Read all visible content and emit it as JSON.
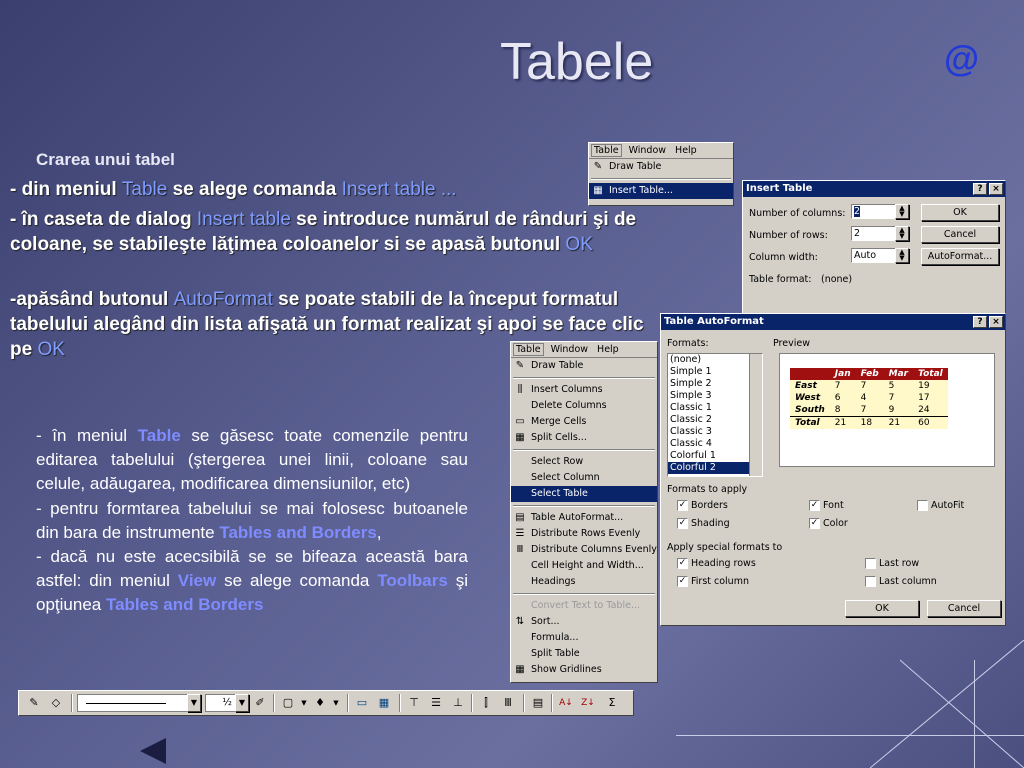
{
  "slide": {
    "title": "Tabele",
    "at_symbol": "@",
    "subtitle": "Crarea unui tabel",
    "lines": [
      {
        "a": "- din meniul ",
        "b": "Table",
        "c": " se alege comanda ",
        "d": "Insert table ..."
      },
      {
        "a": "- în caseta de dialog ",
        "b": "Insert table",
        "c": " se introduce numărul de rânduri şi de coloane, se stabileşte lăţimea coloanelor si se apasă butonul ",
        "d": "OK"
      },
      {
        "a": "-apăsând butonul ",
        "b": "AutoFormat",
        "c": " se poate stabili de la început formatul tabelului alegând din lista afişată un format realizat şi apoi se face clic pe ",
        "d": "OK"
      }
    ],
    "para2": {
      "p1a": "- în meniul ",
      "p1b": "Table",
      "p1c": "  se găsesc toate comenzile pentru editarea tabelului (ştergerea unei linii, coloane sau celule, adăugarea, modificarea dimensiunilor, etc)",
      "p2a": "- pentru formtarea tabelului se mai folosesc butoanele din bara de instrumente ",
      "p2b": "Tables and Borders",
      "p2c": ",",
      "p3a": "- dacă nu este acecsibilă se se bifeaza această bara astfel: din meniul ",
      "p3b": "View",
      "p3c": "  se alege comanda ",
      "p3d": "Toolbars",
      "p3e": " şi opţiunea ",
      "p3f": "Tables and Borders"
    }
  },
  "small_menu": {
    "menubar": [
      "Table",
      "Window",
      "Help"
    ],
    "items": [
      "Draw Table",
      "Insert Table..."
    ]
  },
  "insert_table": {
    "title": "Insert Table",
    "help_btn": "?",
    "close_btn": "×",
    "cols_label": "Number of columns:",
    "cols_value": "2",
    "rows_label": "Number of rows:",
    "rows_value": "2",
    "width_label": "Column width:",
    "width_value": "Auto",
    "format_label": "Table format:",
    "format_value": "(none)",
    "ok": "OK",
    "cancel": "Cancel",
    "autoformat": "AutoFormat..."
  },
  "autoformat": {
    "title": "Table AutoFormat",
    "help_btn": "?",
    "close_btn": "×",
    "formats_label": "Formats:",
    "preview_label": "Preview",
    "formats": [
      "(none)",
      "Simple 1",
      "Simple 2",
      "Simple 3",
      "Classic 1",
      "Classic 2",
      "Classic 3",
      "Classic 4",
      "Colorful 1",
      "Colorful 2"
    ],
    "preview": {
      "header": [
        "",
        "Jan",
        "Feb",
        "Mar",
        "Total"
      ],
      "rows": [
        [
          "East",
          "7",
          "7",
          "5",
          "19"
        ],
        [
          "West",
          "6",
          "4",
          "7",
          "17"
        ],
        [
          "South",
          "8",
          "7",
          "9",
          "24"
        ],
        [
          "Total",
          "21",
          "18",
          "21",
          "60"
        ]
      ]
    },
    "apply_label": "Formats to apply",
    "borders": "Borders",
    "font": "Font",
    "autofit": "AutoFit",
    "shading": "Shading",
    "color": "Color",
    "special_label": "Apply special formats to",
    "heading_rows": "Heading rows",
    "last_row": "Last row",
    "first_column": "First column",
    "last_column": "Last column",
    "ok": "OK",
    "cancel": "Cancel"
  },
  "table_menu": {
    "menubar": [
      "Table",
      "Window",
      "Help"
    ],
    "items": [
      "Draw Table",
      "Insert Columns",
      "Delete Columns",
      "Merge Cells",
      "Split Cells...",
      "Select Row",
      "Select Column",
      "Select Table",
      "Table AutoFormat...",
      "Distribute Rows Evenly",
      "Distribute Columns Evenly",
      "Cell Height and Width...",
      "Headings",
      "Convert Text to Table...",
      "Sort...",
      "Formula...",
      "Split Table",
      "Show Gridlines"
    ]
  },
  "toolbar": {
    "line_weight": "½",
    "sigma": "Σ"
  }
}
